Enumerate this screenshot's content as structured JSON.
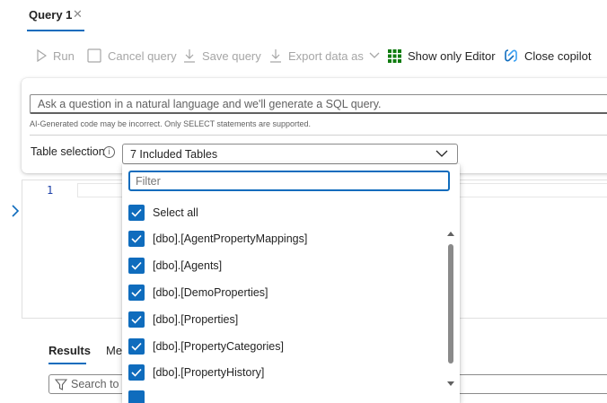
{
  "tab": {
    "title": "Query 1",
    "close": "✕"
  },
  "toolbar": {
    "run": "Run",
    "cancel": "Cancel query",
    "save": "Save query",
    "export": "Export data as",
    "show_editor": "Show only Editor",
    "close_copilot": "Close copilot"
  },
  "copilot": {
    "ask_placeholder": "Ask a question in a natural language and we'll generate a SQL query.",
    "disclaimer": "AI-Generated code may be incorrect. Only SELECT statements are supported.",
    "table_label": "Table selection",
    "info": "i",
    "dropdown_value": "7 Included Tables"
  },
  "editor": {
    "line_number": "1"
  },
  "results": {
    "tab_results": "Results",
    "tab_messages": "Me",
    "search_placeholder": "Search to f"
  },
  "dropdown": {
    "filter_placeholder": "Filter",
    "options": [
      "Select all",
      "[dbo].[AgentPropertyMappings]",
      "[dbo].[Agents]",
      "[dbo].[DemoProperties]",
      "[dbo].[Properties]",
      "[dbo].[PropertyCategories]",
      "[dbo].[PropertyHistory]"
    ]
  },
  "colors": {
    "accent": "#0f6cbd",
    "grid_icon": "#107c10"
  }
}
